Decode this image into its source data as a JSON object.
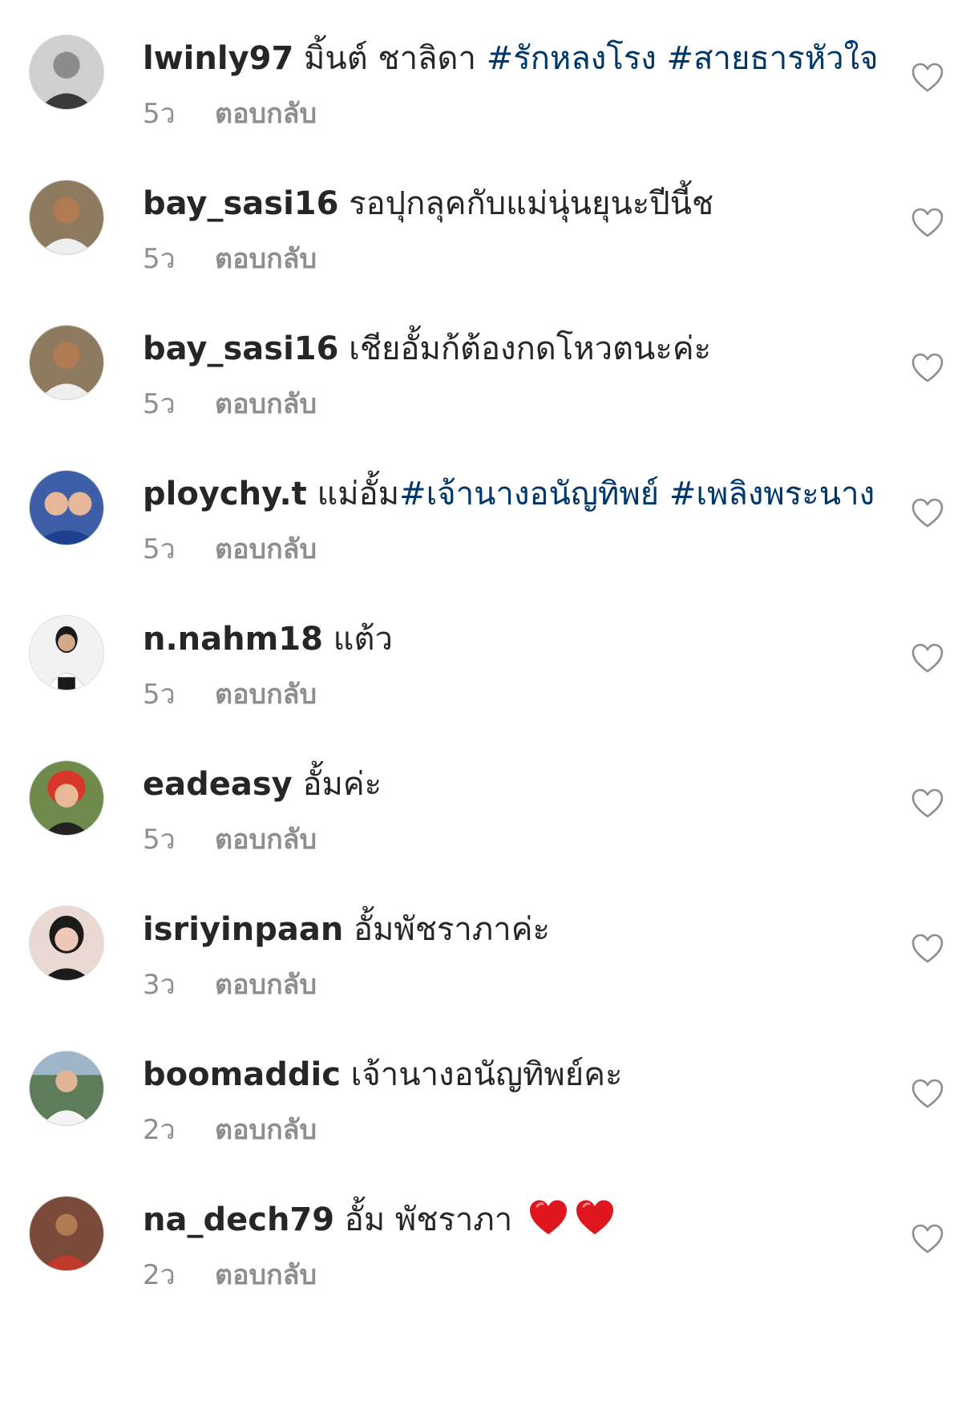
{
  "comments": [
    {
      "username": "lwinly97",
      "text": " มิ้นต์ ชาลิดา ",
      "hashtags": "#รักหลงโรง #สายธารหัวใจ",
      "age": "5ว",
      "reply": "ตอบกลับ",
      "avatar_colors": {
        "bg": "#cfcfcf",
        "face": "#8c8c8c",
        "shirt": "#3a3a3a"
      }
    },
    {
      "username": "bay_sasi16",
      "text": " รอปุกลุคกับแม่นุ่นยุนะปีนี้ช",
      "hashtags": "",
      "age": "5ว",
      "reply": "ตอบกลับ",
      "avatar_colors": {
        "bg": "#8d7a5f",
        "face": "#b07a52",
        "shirt": "#eeeeee"
      }
    },
    {
      "username": "bay_sasi16",
      "text": " เชียอั้มก้ต้องกดโหวตนะค่ะ",
      "hashtags": "",
      "age": "5ว",
      "reply": "ตอบกลับ",
      "avatar_colors": {
        "bg": "#8d7a5f",
        "face": "#b07a52",
        "shirt": "#eeeeee"
      }
    },
    {
      "username": "ploychy.t",
      "text": " แม่อั้ม",
      "hashtags": "#เจ้านางอนัญทิพย์ #เพลิงพระนาง",
      "age": "5ว",
      "reply": "ตอบกลับ",
      "avatar_colors": {
        "bg": "#3e5fa8",
        "face": "#e7b79a",
        "shirt": "#1f3f8f"
      }
    },
    {
      "username": "n.nahm18",
      "text": " แต้ว",
      "hashtags": "",
      "age": "5ว",
      "reply": "ตอบกลับ",
      "avatar_colors": {
        "bg": "#f2f2f2",
        "face": "#d4a98a",
        "shirt": "#ffffff"
      }
    },
    {
      "username": "eadeasy",
      "text": " อั้มค่ะ",
      "hashtags": "",
      "age": "5ว",
      "reply": "ตอบกลับ",
      "avatar_colors": {
        "bg": "#6f8a4a",
        "face": "#e8b89a",
        "shirt": "#222222"
      }
    },
    {
      "username": "isriyinpaan",
      "text": " อั้มพัชราภาค่ะ",
      "hashtags": "",
      "age": "3ว",
      "reply": "ตอบกลับ",
      "avatar_colors": {
        "bg": "#e9d9d2",
        "face": "#f0c8b8",
        "shirt": "#1b1b1b"
      }
    },
    {
      "username": "boomaddic",
      "text": " เจ้านางอนัญทิพย์คะ",
      "hashtags": "",
      "age": "2ว",
      "reply": "ตอบกลับ",
      "avatar_colors": {
        "bg": "#5d7d5a",
        "face": "#e0b596",
        "shirt": "#f4f4f4"
      }
    },
    {
      "username": "na_dech79",
      "text": " อั้ม พัชราภา ",
      "hashtags": "",
      "emoji": "❤️❤️",
      "age": "2ว",
      "reply": "ตอบกลับ",
      "avatar_colors": {
        "bg": "#7a4a3a",
        "face": "#b07a52",
        "shirt": "#c0392b"
      }
    }
  ],
  "colors": {
    "text": "#262626",
    "hashtag": "#00376b",
    "meta": "#8e8e8e",
    "heart_outline": "#8e8e8e",
    "emoji_heart": "#e0161f"
  },
  "icons": {
    "like": "heart-outline-icon",
    "emoji": "red-heart-emoji"
  }
}
